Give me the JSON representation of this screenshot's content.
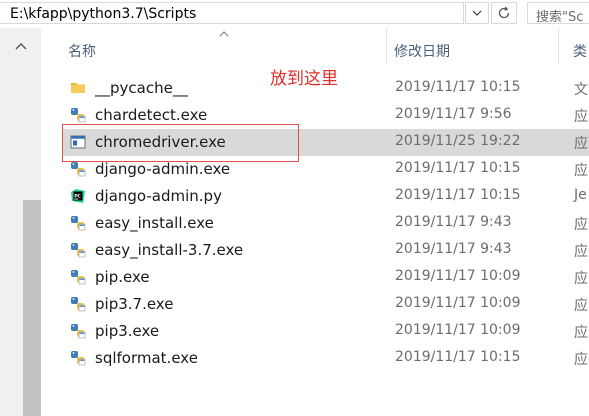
{
  "address_bar": {
    "path": "E:\\kfapp\\python3.7\\Scripts",
    "search_placeholder": "搜索\"Sc"
  },
  "columns": {
    "name": "名称",
    "modified": "修改日期",
    "type": "类"
  },
  "annotation": "放到这里",
  "files": [
    {
      "name": "__pycache__",
      "date": "2019/11/17 10:15",
      "type": "文",
      "icon": "folder-icon"
    },
    {
      "name": "chardetect.exe",
      "date": "2019/11/17 9:56",
      "type": "应",
      "icon": "python-exe-icon"
    },
    {
      "name": "chromedriver.exe",
      "date": "2019/11/25 19:22",
      "type": "应",
      "icon": "exe-window-icon",
      "selected": true
    },
    {
      "name": "django-admin.exe",
      "date": "2019/11/17 10:15",
      "type": "应",
      "icon": "python-exe-icon"
    },
    {
      "name": "django-admin.py",
      "date": "2019/11/17 10:15",
      "type": "Je",
      "icon": "pycharm-icon"
    },
    {
      "name": "easy_install.exe",
      "date": "2019/11/17 9:43",
      "type": "应",
      "icon": "python-exe-icon"
    },
    {
      "name": "easy_install-3.7.exe",
      "date": "2019/11/17 9:43",
      "type": "应",
      "icon": "python-exe-icon"
    },
    {
      "name": "pip.exe",
      "date": "2019/11/17 10:09",
      "type": "应",
      "icon": "python-exe-icon"
    },
    {
      "name": "pip3.7.exe",
      "date": "2019/11/17 10:09",
      "type": "应",
      "icon": "python-exe-icon"
    },
    {
      "name": "pip3.exe",
      "date": "2019/11/17 10:09",
      "type": "应",
      "icon": "python-exe-icon"
    },
    {
      "name": "sqlformat.exe",
      "date": "2019/11/17 10:15",
      "type": "应",
      "icon": "python-exe-icon"
    }
  ]
}
